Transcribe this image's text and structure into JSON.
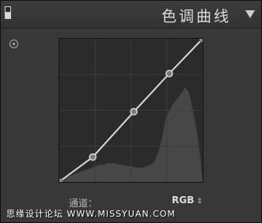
{
  "header": {
    "title": "色调曲线"
  },
  "icons": {
    "panel_toggle": "panel-toggle-icon",
    "collapse": "collapse-triangle-icon",
    "targeted_adjustment": "target-adjust-icon"
  },
  "curve": {
    "control_points": [
      [
        0,
        0
      ],
      [
        0.23,
        0.17
      ],
      [
        0.52,
        0.49
      ],
      [
        0.77,
        0.76
      ],
      [
        1,
        1
      ]
    ],
    "histogram": [
      0.02,
      0.03,
      0.04,
      0.05,
      0.06,
      0.07,
      0.08,
      0.09,
      0.1,
      0.11,
      0.12,
      0.12,
      0.13,
      0.13,
      0.13,
      0.12,
      0.12,
      0.11,
      0.11,
      0.1,
      0.1,
      0.1,
      0.11,
      0.12,
      0.14,
      0.2,
      0.3,
      0.45,
      0.5,
      0.55,
      0.58,
      0.62,
      0.66,
      0.62,
      0.5,
      0.35,
      0.15
    ]
  },
  "channel": {
    "label": "通道：",
    "value": "RGB",
    "arrows": "⇕"
  },
  "colors": {
    "panel_bg": "#383838",
    "curve_bg": "#2b2b2b",
    "grid": "#3d3d3d",
    "curve_line": "#d8d8d8",
    "histogram": "#474747"
  },
  "watermark": "思缘设计论坛  WWW.MISSYUAN.COM"
}
